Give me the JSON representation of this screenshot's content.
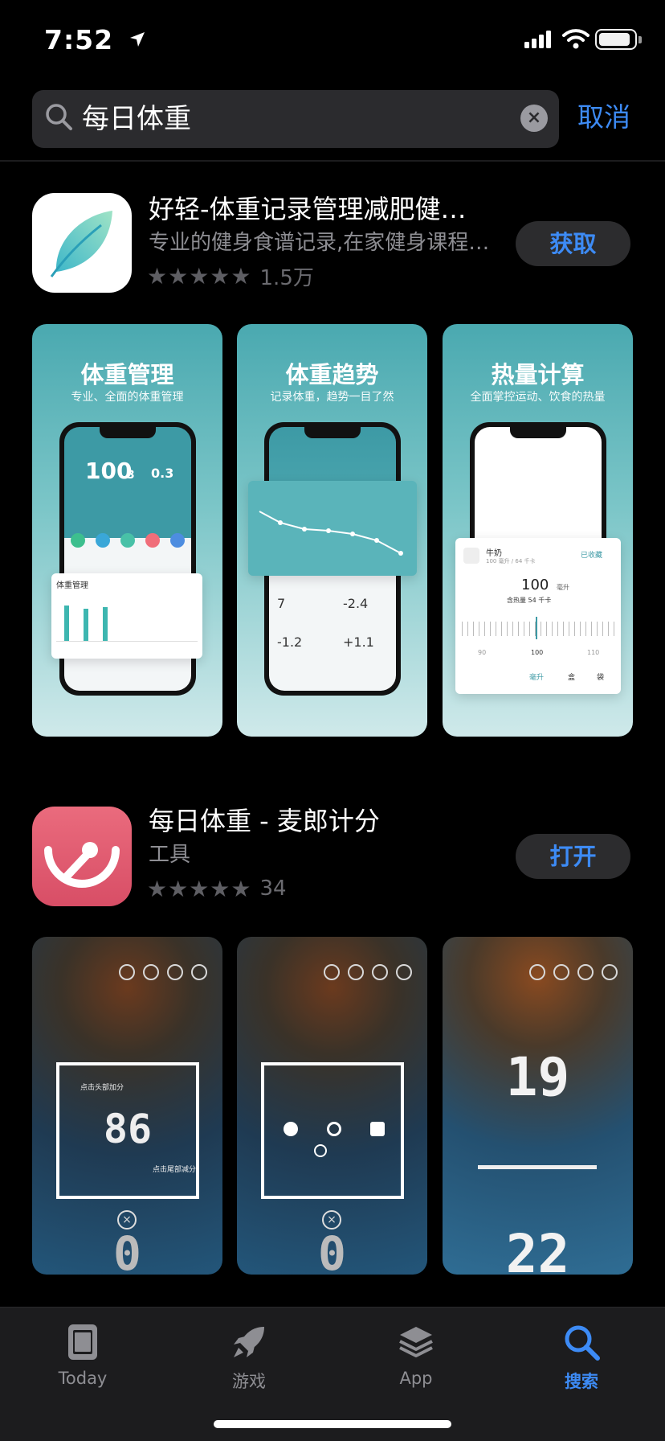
{
  "status": {
    "time": "7:52",
    "battery_level": 0.9
  },
  "search": {
    "query": "每日体重",
    "cancel_label": "取消"
  },
  "apps": [
    {
      "title": "好轻-体重记录管理减肥健…",
      "subtitle": "专业的健身食谱记录,在家健身课程…",
      "stars": "★★★★★",
      "rating_count": "1.5万",
      "button_label": "获取",
      "screens": [
        {
          "title": "体重管理",
          "caption": "专业、全面的体重管理"
        },
        {
          "title": "体重趋势",
          "caption": "记录体重，趋势一目了然"
        },
        {
          "title": "热量计算",
          "caption": "全面掌控运动、饮食的热量"
        }
      ],
      "s1": {
        "weight": "100",
        "weight_dec": "3",
        "delta": "0.3",
        "card_title": "体重管理"
      },
      "s2": {
        "stat1": "7",
        "stat2": "-2.4",
        "stat3": "-1.2",
        "stat4": "+1.1"
      },
      "s3": {
        "food": "牛奶",
        "food_sub": "100 毫升 / 64 千卡",
        "saved": "已收藏",
        "amount": "100",
        "unit": "毫升",
        "total": "含热量 54 千卡",
        "scale": [
          "90",
          "100",
          "110"
        ],
        "units": [
          "毫升",
          "盒",
          "袋"
        ]
      }
    },
    {
      "title": "每日体重 - 麦郎计分",
      "subtitle": "工具",
      "stars": "★★★★★",
      "rating_count": "34",
      "button_label": "打开",
      "screens": [
        {
          "big": "86",
          "bottom": "0",
          "hint_top": "点击头部加分",
          "hint_bottom": "点击尾部减分"
        },
        {
          "bottom": "0"
        },
        {
          "top": "19",
          "bottom": "22"
        }
      ]
    }
  ],
  "tabs": [
    {
      "label": "Today",
      "icon": "today-icon"
    },
    {
      "label": "游戏",
      "icon": "rocket-icon"
    },
    {
      "label": "App",
      "icon": "layers-icon"
    },
    {
      "label": "搜索",
      "icon": "search-icon"
    }
  ],
  "colors": {
    "accent": "#3d8bf5",
    "background": "#000000",
    "button_bg": "#2c2c2e"
  }
}
